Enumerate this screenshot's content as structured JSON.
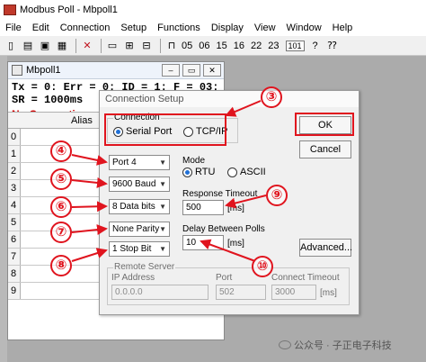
{
  "window": {
    "title": "Modbus Poll - Mbpoll1"
  },
  "menu": [
    "File",
    "Edit",
    "Connection",
    "Setup",
    "Functions",
    "Display",
    "View",
    "Window",
    "Help"
  ],
  "toolbar": {
    "function_codes": [
      "05",
      "06",
      "15",
      "16",
      "22",
      "23"
    ],
    "box_label": "101"
  },
  "child": {
    "title": "Mbpoll1",
    "status": "Tx = 0: Err = 0: ID = 1: F = 03: SR = 1000ms",
    "no_connection": "No Connection",
    "alias_header": "Alias",
    "rows": [
      "0",
      "1",
      "2",
      "3",
      "4",
      "5",
      "6",
      "7",
      "8",
      "9"
    ]
  },
  "dialog": {
    "title": "Connection Setup",
    "connection": {
      "legend": "Connection",
      "serial": "Serial Port",
      "tcpip": "TCP/IP"
    },
    "port": "Port 4",
    "baud": "9600 Baud",
    "databits": "8 Data bits",
    "parity": "None Parity",
    "stopbit": "1 Stop Bit",
    "mode": {
      "legend": "Mode",
      "rtu": "RTU",
      "ascii": "ASCII"
    },
    "response_timeout": {
      "label": "Response Timeout",
      "value": "500",
      "unit": "[ms]"
    },
    "delay_polls": {
      "label": "Delay Between Polls",
      "value": "10",
      "unit": "[ms]"
    },
    "advanced": "Advanced...",
    "ok": "OK",
    "cancel": "Cancel",
    "remote": {
      "legend": "Remote Server",
      "ip_label": "IP Address",
      "ip_value": "0.0.0.0",
      "port_label": "Port",
      "port_value": "502",
      "timeout_label": "Connect Timeout",
      "timeout_value": "3000",
      "timeout_unit": "[ms]"
    }
  },
  "annotations": {
    "n3": "③",
    "n4": "④",
    "n5": "⑤",
    "n6": "⑥",
    "n7": "⑦",
    "n8": "⑧",
    "n9": "⑨",
    "n10": "⑩"
  },
  "watermark": "公众号 · 子正电子科技",
  "colors": {
    "highlight": "#e0141e",
    "no_connection": "#d00000",
    "radio_selected": "#1f6fd6"
  }
}
